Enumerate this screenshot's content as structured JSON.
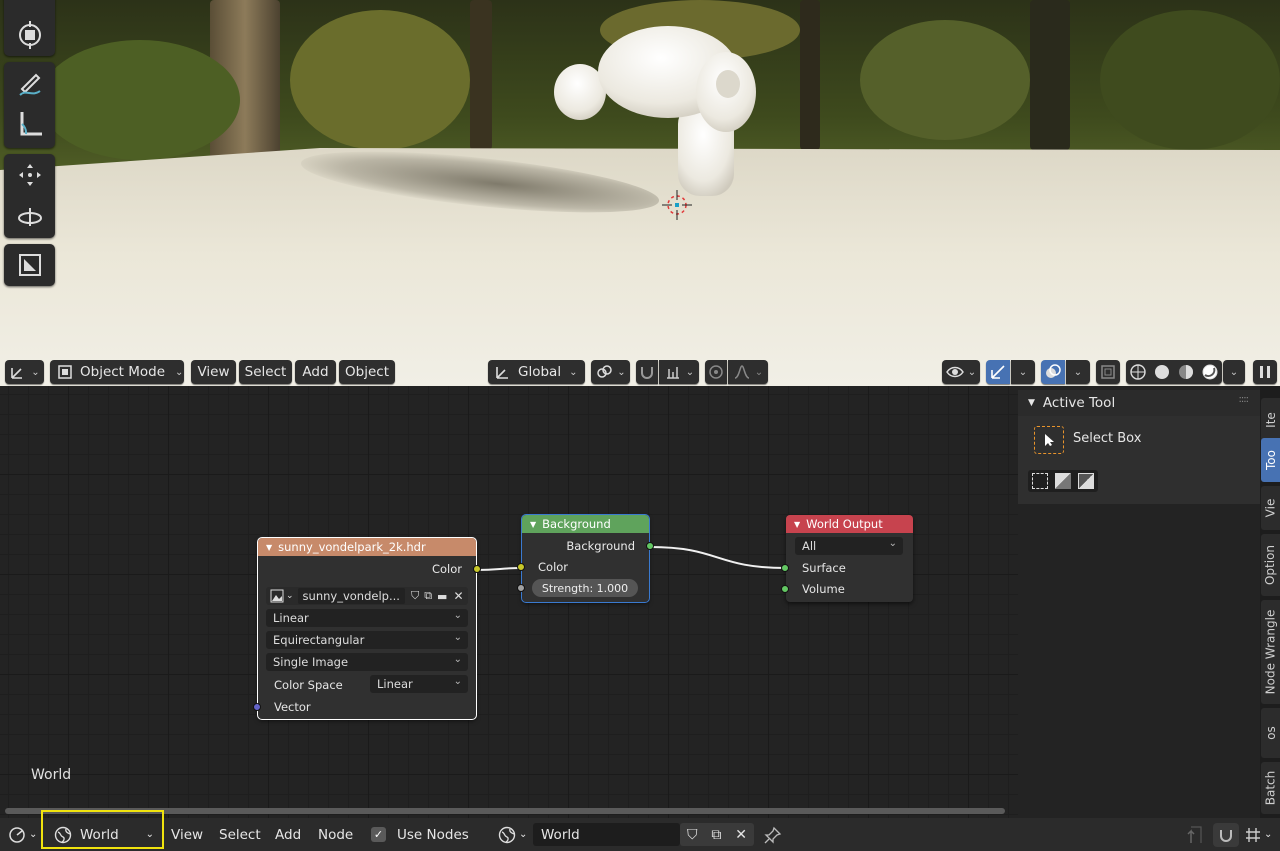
{
  "viewport": {
    "header": {
      "mode": "Object Mode",
      "menus": [
        "View",
        "Select",
        "Add",
        "Object"
      ],
      "orientation": "Global"
    },
    "tools": [
      "select-icon",
      "cursor-icon",
      "annotate-icon",
      "measure-icon",
      "move-icon",
      "rotate-icon",
      "scale-icon"
    ]
  },
  "node_editor": {
    "world_label": "World",
    "nodes": {
      "image": {
        "title": "sunny_vondelpark_2k.hdr",
        "output": "Color",
        "image_name": "sunny_vondelp...",
        "interpolation": "Linear",
        "projection": "Equirectangular",
        "source": "Single Image",
        "color_space_label": "Color Space",
        "color_space": "Linear",
        "input": "Vector"
      },
      "background": {
        "title": "Background",
        "output": "Background",
        "input_color": "Color",
        "strength": "Strength: 1.000"
      },
      "output": {
        "title": "World Output",
        "target": "All",
        "surface": "Surface",
        "volume": "Volume"
      }
    },
    "header_colors": {
      "texture": "#c78a6a",
      "shader": "#5fa35c",
      "output": "#c7434e"
    }
  },
  "sidebar": {
    "panel_title": "Active Tool",
    "tool_name": "Select Box",
    "tabs": [
      "Ite",
      "Too",
      "Vie",
      "Option",
      "Node Wrangle",
      "os",
      "Batch"
    ],
    "active_tab": "Too"
  },
  "bottom_bar": {
    "shader_type": "World",
    "menus": [
      "View",
      "Select",
      "Add",
      "Node"
    ],
    "use_nodes_label": "Use Nodes",
    "use_nodes_checked": true,
    "world_name": "World"
  }
}
